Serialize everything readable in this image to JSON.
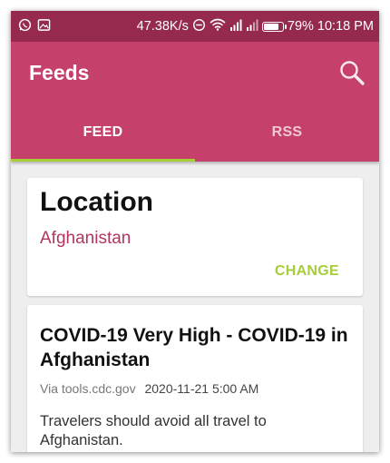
{
  "status_bar": {
    "network_speed": "47.38K/s",
    "battery_percent": "79%",
    "battery_level": 0.79,
    "time": "10:18 PM",
    "left_icons": [
      "whatsapp-icon",
      "image-icon"
    ],
    "right_icons": [
      "dnd-icon",
      "wifi-icon",
      "signal-icon",
      "signal-icon",
      "battery-icon"
    ]
  },
  "app_bar": {
    "title": "Feeds"
  },
  "tabs": [
    {
      "label": "FEED",
      "active": true
    },
    {
      "label": "RSS",
      "active": false
    }
  ],
  "location_card": {
    "heading": "Location",
    "value": "Afghanistan",
    "action_label": "CHANGE"
  },
  "feed_item": {
    "title": "COVID-19 Very High - COVID-19 in Afghanistan",
    "source": "Via tools.cdc.gov",
    "date": "2020-11-21 5:00 AM",
    "summary": "Travelers should avoid all travel to Afghanistan."
  },
  "colors": {
    "status_bar": "#96294e",
    "app_bar": "#c5416b",
    "tab_indicator": "#a6ce39",
    "location_text": "#b03560",
    "action_text": "#a6ce39"
  }
}
